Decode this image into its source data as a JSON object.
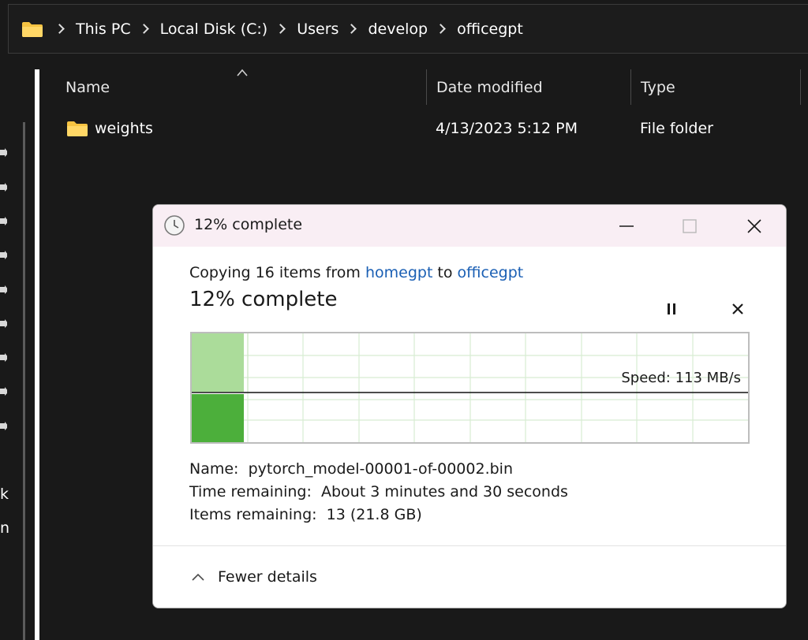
{
  "address_bar": {
    "crumbs": [
      "This PC",
      "Local Disk (C:)",
      "Users",
      "develop",
      "officegpt"
    ]
  },
  "columns": {
    "name": "Name",
    "date_modified": "Date modified",
    "type": "Type"
  },
  "files": [
    {
      "name": "weights",
      "date_modified": "4/13/2023 5:12 PM",
      "type": "File folder"
    }
  ],
  "nav_fragments": [
    "k",
    "n"
  ],
  "dialog": {
    "title": "12% complete",
    "copy_prefix": "Copying 16 items from ",
    "source": "homegpt",
    "to_word": " to ",
    "destination": "officegpt",
    "percent_label": "12% complete",
    "progress_fraction": 0.12,
    "speed": "Speed: 113 MB/s",
    "name_label": "Name:",
    "name_value": "pytorch_model-00001-of-00002.bin",
    "time_label": "Time remaining:",
    "time_value": "About 3 minutes and 30 seconds",
    "items_label": "Items remaining:",
    "items_value": "13 (21.8 GB)",
    "fewer_details": "Fewer details"
  },
  "colors": {
    "accent_link": "#1a5fb4",
    "progress_light": "#abdc9a",
    "progress_dark": "#4caf3b",
    "folder": "#f6c342"
  }
}
